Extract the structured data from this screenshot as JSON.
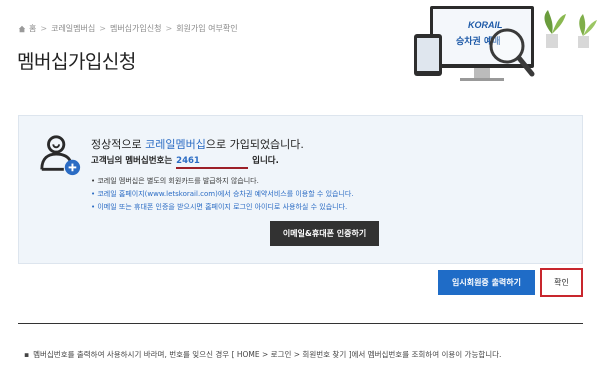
{
  "breadcrumb": {
    "items": [
      "홈",
      "코레일멤버십",
      "멤버십가입신청",
      "회원가입 여부확인"
    ]
  },
  "page": {
    "title": "멤버십가입신청"
  },
  "banner": {
    "brand_text": "KORAIL",
    "screen_text": "승차권 예매"
  },
  "success": {
    "headline_prefix": "정상적으로 ",
    "headline_brand": "코레일멤버십",
    "headline_suffix": "으로 가입되었습니다.",
    "subline_prefix": "고객님의 멤버십번호는",
    "member_number": "2461",
    "subline_suffix": "입니다.",
    "notes": [
      "코레일 멤버십은 별도의 회원카드를 발급하지 않습니다.",
      "코레일 홈페이지(www.letskorail.com)에서 승차권 예약서비스를 이용할 수 있습니다.",
      "이메일 또는 휴대폰 인증을 받으시면 홈페이지 로그인 아이디로 사용하실 수 있습니다."
    ],
    "verify_button": "이메일&휴대폰 인증하기"
  },
  "actions": {
    "print_button": "임시회원증 출력하기",
    "confirm_button": "확인"
  },
  "footer": {
    "note": "멤버십번호를 출력하여 사용하시기 바라며, 번호를 잊으신 경우 [ HOME > 로그인 > 회원번호 찾기 ]에서 멤버십번호를 조회하여 이용이 가능합니다."
  },
  "colors": {
    "accent": "#2b6cc4",
    "highlight": "#c8262d",
    "primary_button": "#1f6cc7",
    "dark_button": "#323232",
    "panel_bg": "#f0f5fa"
  }
}
